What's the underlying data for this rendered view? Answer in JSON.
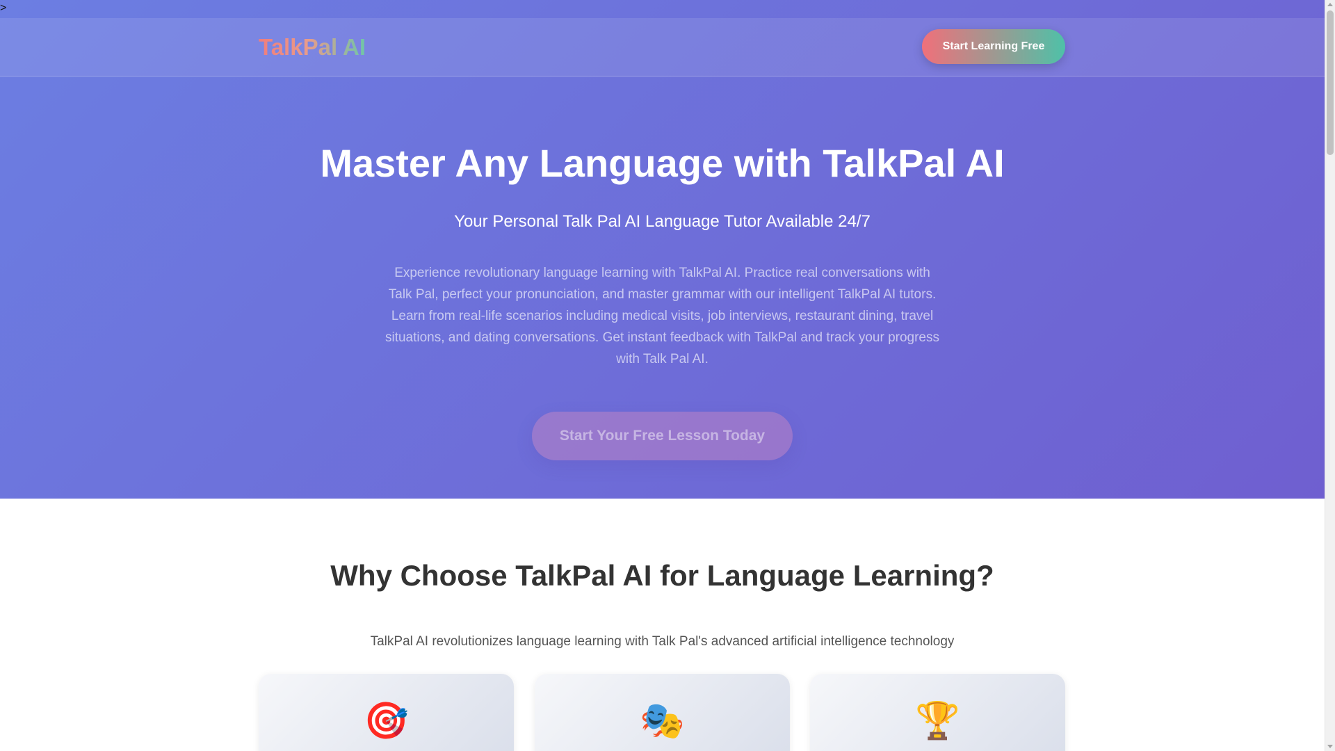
{
  "stray_text": ">",
  "nav": {
    "logo": "TalkPal AI",
    "cta_label": "Start Learning Free"
  },
  "hero": {
    "title": "Master Any Language with TalkPal AI",
    "subtitle": "Your Personal Talk Pal AI Language Tutor Available 24/7",
    "description": "Experience revolutionary language learning with TalkPal AI. Practice real conversations with Talk Pal, perfect your pronunciation, and master grammar with our intelligent TalkPal AI tutors. Learn from real-life scenarios including medical visits, job interviews, restaurant dining, travel situations, and dating conversations. Get instant feedback with TalkPal and track your progress with Talk Pal AI.",
    "cta_label": "Start Your Free Lesson Today"
  },
  "features": {
    "title": "Why Choose TalkPal AI for Language Learning?",
    "subtitle": "TalkPal AI revolutionizes language learning with Talk Pal's advanced artificial intelligence technology",
    "cards": [
      {
        "icon": "target-icon",
        "emoji": "🎯"
      },
      {
        "icon": "theater-masks-icon",
        "emoji": "🎭"
      },
      {
        "icon": "trophy-icon",
        "emoji": "🏆"
      }
    ]
  },
  "colors": {
    "hero_gradient_start": "#6c7ee2",
    "hero_gradient_end": "#6f5fd0",
    "cta_gradient_start": "#f0707a",
    "cta_gradient_end": "#4ec1a8",
    "heading_text": "#333333"
  }
}
